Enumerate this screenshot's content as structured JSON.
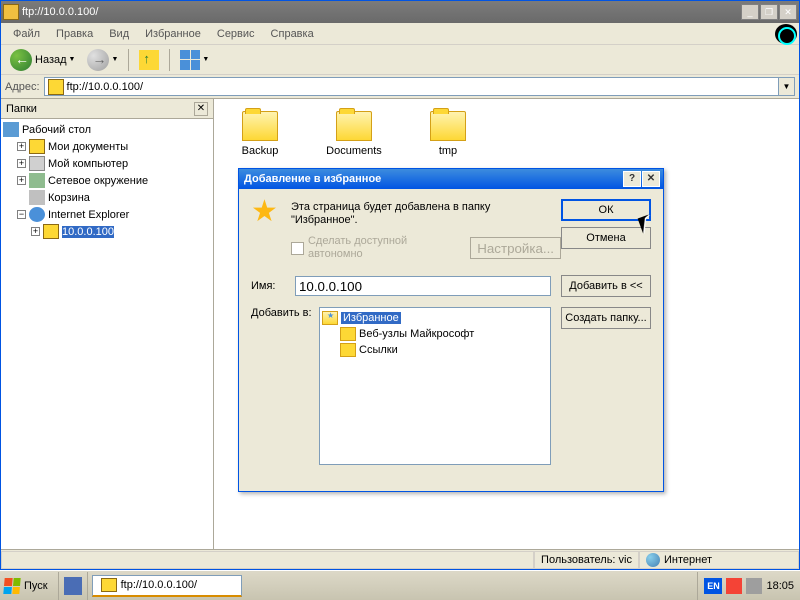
{
  "window": {
    "title": "ftp://10.0.0.100/"
  },
  "menu": {
    "file": "Файл",
    "edit": "Правка",
    "view": "Вид",
    "favorites": "Избранное",
    "tools": "Сервис",
    "help": "Справка"
  },
  "toolbar": {
    "back": "Назад"
  },
  "address": {
    "label": "Адрес:",
    "value": "ftp://10.0.0.100/"
  },
  "folders_panel": {
    "title": "Папки",
    "tree": {
      "desktop": "Рабочий стол",
      "my_docs": "Мои документы",
      "my_computer": "Мой компьютер",
      "network": "Сетевое окружение",
      "trash": "Корзина",
      "ie": "Internet Explorer",
      "ftp_node": "10.0.0.100"
    }
  },
  "content_folders": [
    {
      "name": "Backup"
    },
    {
      "name": "Documents"
    },
    {
      "name": "tmp"
    }
  ],
  "dialog": {
    "title": "Добавление в избранное",
    "message_line1": "Эта страница будет добавлена в папку",
    "message_line2": "\"Избранное\".",
    "ok": "ОК",
    "cancel": "Отмена",
    "make_offline": "Сделать доступной автономно",
    "settings": "Настройка...",
    "name_label": "Имя:",
    "name_value": "10.0.0.100",
    "add_to_btn": "Добавить в <<",
    "add_to_label": "Добавить в:",
    "create_folder": "Создать папку...",
    "tree": {
      "favorites": "Избранное",
      "ms_links": "Веб-узлы Майкрософт",
      "links": "Ссылки"
    }
  },
  "statusbar": {
    "user": "Пользователь: vic",
    "zone": "Интернет"
  },
  "taskbar": {
    "start": "Пуск",
    "task1": "ftp://10.0.0.100/",
    "lang": "EN",
    "time": "18:05"
  }
}
